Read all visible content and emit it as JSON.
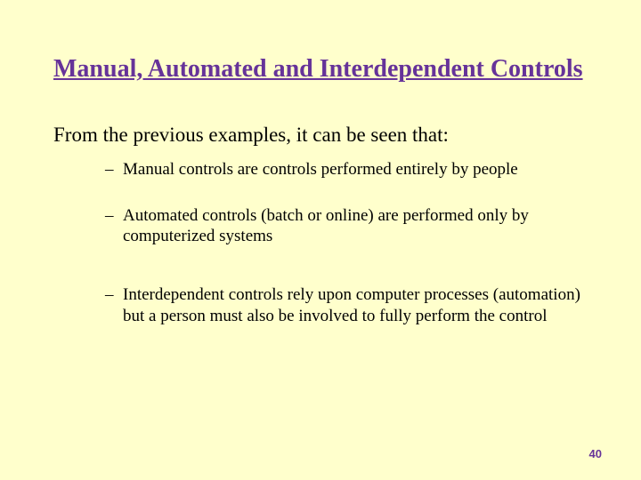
{
  "title": "Manual, Automated and Interdependent Controls",
  "intro": "From the previous examples, it can be seen that:",
  "bullets": [
    "Manual controls are controls performed entirely by people",
    "Automated controls (batch or online) are performed only by computerized systems",
    "Interdependent controls rely upon computer processes (automation) but a person must also be involved to fully perform the control"
  ],
  "page_number": "40"
}
